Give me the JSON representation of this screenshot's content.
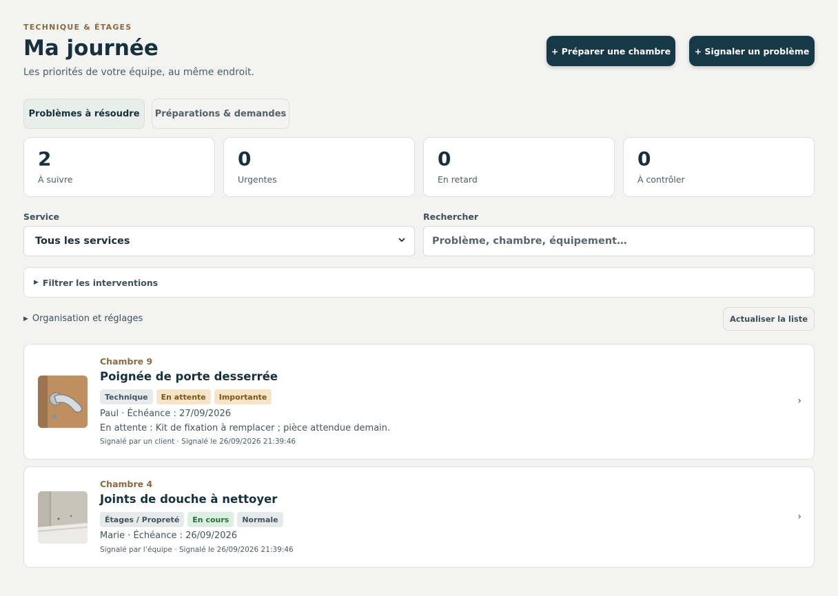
{
  "header": {
    "eyebrow": "TECHNIQUE & ÉTAGES",
    "title": "Ma journée",
    "subtitle": "Les priorités de votre équipe, au même endroit.",
    "prepare_label": "+ Préparer une chambre",
    "report_label": "+ Signaler un problème"
  },
  "tabs": [
    {
      "label": "Problèmes à résoudre",
      "active": true
    },
    {
      "label": "Préparations & demandes",
      "active": false
    }
  ],
  "stats": [
    {
      "value": "2",
      "label": "À suivre"
    },
    {
      "value": "0",
      "label": "Urgentes"
    },
    {
      "value": "0",
      "label": "En retard"
    },
    {
      "value": "0",
      "label": "À contrôler"
    }
  ],
  "filters": {
    "service_label": "Service",
    "service_value": "Tous les services",
    "search_label": "Rechercher",
    "search_placeholder": "Problème, chambre, équipement…",
    "filter_panel_label": "Filtrer les interventions",
    "org_label": "Organisation et réglages",
    "refresh_label": "Actualiser la liste"
  },
  "issues": [
    {
      "room": "Chambre 9",
      "title": "Poignée de porte desserrée",
      "tags": [
        "Technique",
        "En attente",
        "Importante"
      ],
      "meta": "Paul · Échéance : 27/09/2026",
      "note": "En attente : Kit de fixation à remplacer ; pièce attendue demain.",
      "reported": "Signalé par un client · Signalé le 26/09/2026 21:39:46",
      "thumbnail": "door-handle-photo"
    },
    {
      "room": "Chambre 4",
      "title": "Joints de douche à nettoyer",
      "tags": [
        "Étages / Propreté",
        "En cours",
        "Normale"
      ],
      "meta": "Marie · Échéance : 26/09/2026",
      "reported": "Signalé par l’équipe · Signalé le 26/09/2026 21:39:46",
      "thumbnail": "shower-corner-photo"
    }
  ],
  "icons": {
    "chevron": "›",
    "disclosure": "▶",
    "select_chevron": "⌄"
  },
  "colors": {
    "primary": "#173846",
    "accent": "#8a6a3c",
    "background": "#f3f4f2"
  }
}
